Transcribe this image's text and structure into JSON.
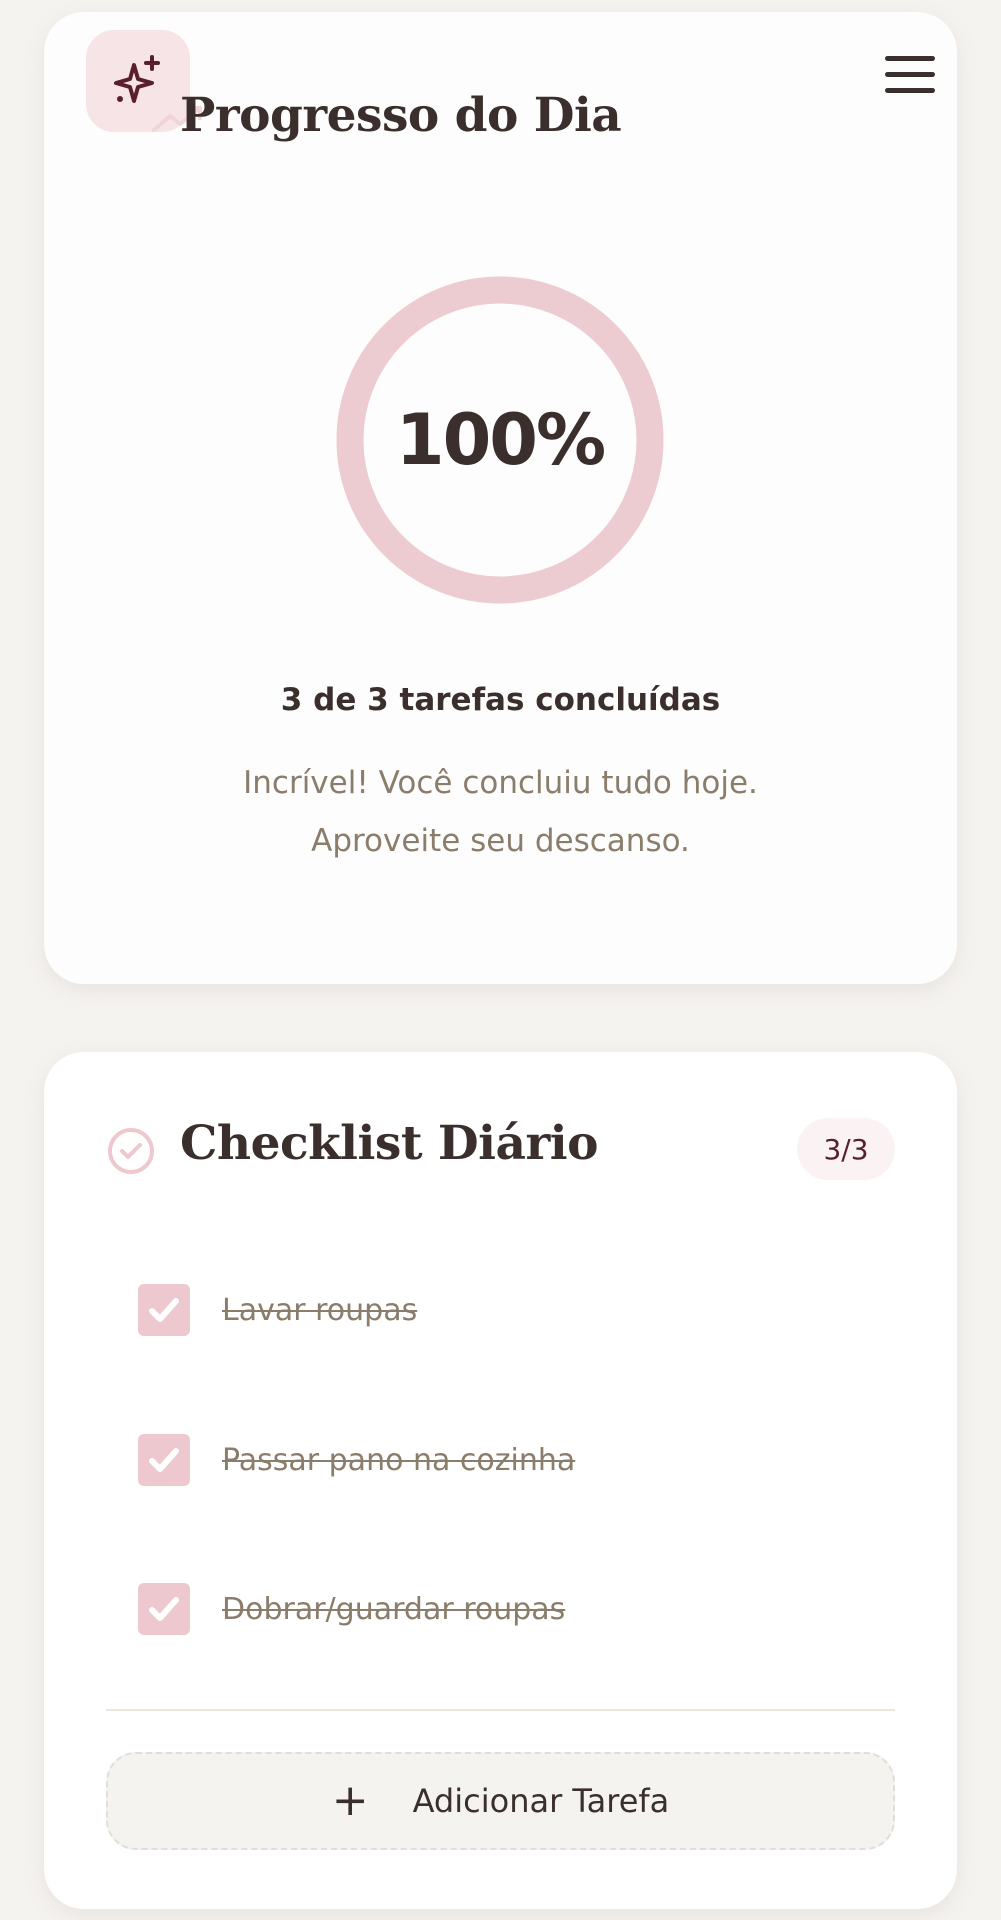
{
  "progress": {
    "title": "Progresso do Dia",
    "percent_label": "100%",
    "percent_value": 100,
    "summary": "3 de 3 tarefas concluídas",
    "message_line1": "Incrível! Você concluiu tudo hoje.",
    "message_line2": "Aproveite seu descanso."
  },
  "checklist": {
    "title": "Checklist Diário",
    "count": "3/3",
    "tasks": [
      {
        "label": "Lavar roupas",
        "done": true
      },
      {
        "label": "Passar pano na cozinha",
        "done": true
      },
      {
        "label": "Dobrar/guardar roupas",
        "done": true
      }
    ],
    "add_label": "Adicionar Tarefa",
    "add_icon": "+"
  },
  "icons": {
    "header": "sparkle-icon",
    "trend": "trending-up-icon",
    "menu": "menu-icon",
    "checklist": "check-circle-icon",
    "task": "checkbox-check-icon"
  },
  "colors": {
    "accent_pink": "#edc8ce",
    "badge_text": "#5a1f2c",
    "muted_text": "#8b7d6b",
    "dark_text": "#3a2f2c"
  }
}
